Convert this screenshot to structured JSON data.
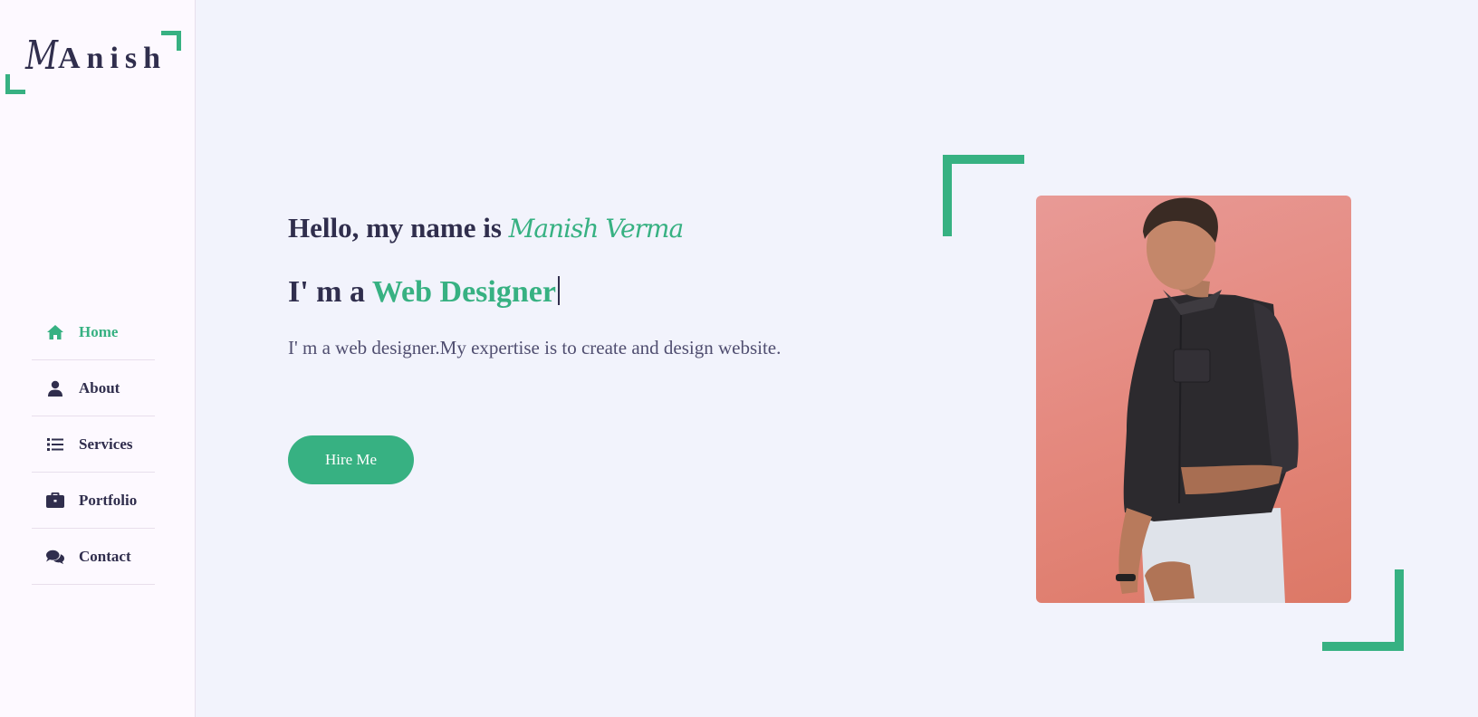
{
  "logo": {
    "initial": "M",
    "rest": "Anish"
  },
  "nav": {
    "items": [
      {
        "label": "Home",
        "icon": "home-icon",
        "active": true
      },
      {
        "label": "About",
        "icon": "user-icon",
        "active": false
      },
      {
        "label": "Services",
        "icon": "list-icon",
        "active": false
      },
      {
        "label": "Portfolio",
        "icon": "briefcase-icon",
        "active": false
      },
      {
        "label": "Contact",
        "icon": "comments-icon",
        "active": false
      }
    ]
  },
  "hero": {
    "greeting": "Hello, my name is ",
    "name": "Manish Verma",
    "role_prefix": "I' m a ",
    "role": "Web Designer",
    "description": "I' m a web designer.My expertise is to create and design website.",
    "button_label": "Hire Me"
  },
  "colors": {
    "accent": "#37b182",
    "text": "#302e4d",
    "background": "#f2f3fc",
    "sidebar": "#fdf9ff"
  }
}
